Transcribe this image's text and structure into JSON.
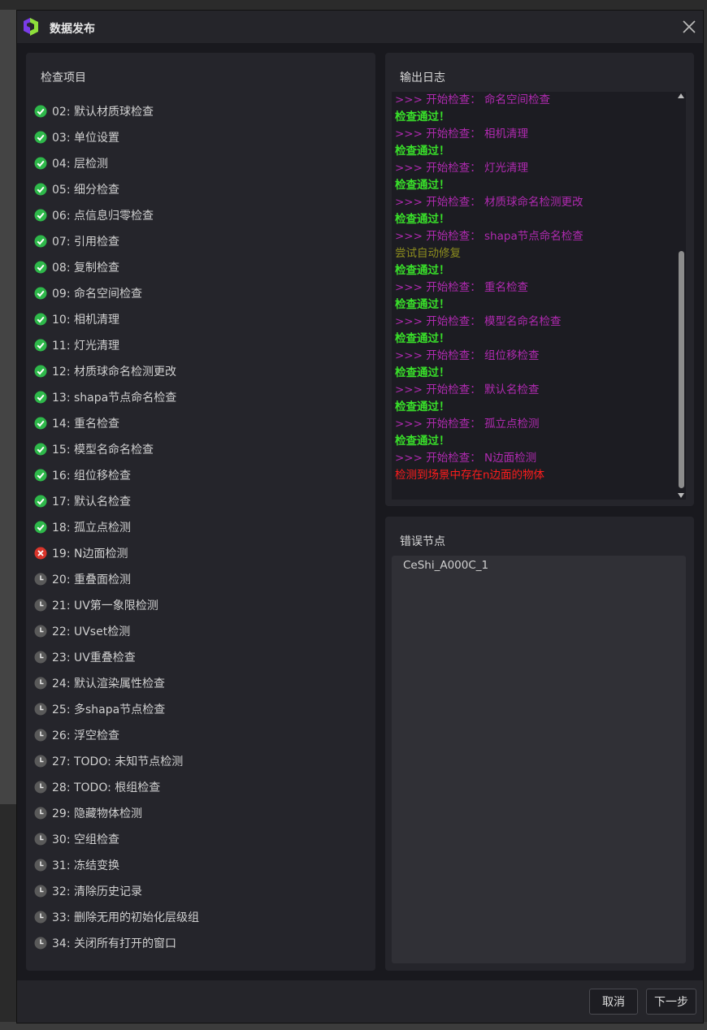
{
  "window": {
    "title": "数据发布"
  },
  "check_panel": {
    "title": "检查项目",
    "items": [
      {
        "label": "02: 默认材质球检查",
        "status": "passed"
      },
      {
        "label": "03: 单位设置",
        "status": "passed"
      },
      {
        "label": "04: 层检测",
        "status": "passed"
      },
      {
        "label": "05: 细分检查",
        "status": "passed"
      },
      {
        "label": "06: 点信息归零检查",
        "status": "passed"
      },
      {
        "label": "07: 引用检查",
        "status": "passed"
      },
      {
        "label": "08: 复制检查",
        "status": "passed"
      },
      {
        "label": "09: 命名空间检查",
        "status": "passed"
      },
      {
        "label": "10: 相机清理",
        "status": "passed"
      },
      {
        "label": "11: 灯光清理",
        "status": "passed"
      },
      {
        "label": "12: 材质球命名检测更改",
        "status": "passed"
      },
      {
        "label": "13: shapa节点命名检查",
        "status": "passed"
      },
      {
        "label": "14: 重名检查",
        "status": "passed"
      },
      {
        "label": "15: 模型名命名检查",
        "status": "passed"
      },
      {
        "label": "16: 组位移检查",
        "status": "passed"
      },
      {
        "label": "17: 默认名检查",
        "status": "passed"
      },
      {
        "label": "18: 孤立点检测",
        "status": "passed"
      },
      {
        "label": "19: N边面检测",
        "status": "failed"
      },
      {
        "label": "20: 重叠面检测",
        "status": "pending"
      },
      {
        "label": "21: UV第一象限检测",
        "status": "pending"
      },
      {
        "label": "22: UVset检测",
        "status": "pending"
      },
      {
        "label": "23: UV重叠检查",
        "status": "pending"
      },
      {
        "label": "24: 默认渲染属性检查",
        "status": "pending"
      },
      {
        "label": "25: 多shapa节点检查",
        "status": "pending"
      },
      {
        "label": "26: 浮空检查",
        "status": "pending"
      },
      {
        "label": "27: TODO: 未知节点检测",
        "status": "pending"
      },
      {
        "label": "28: TODO: 根组检查",
        "status": "pending"
      },
      {
        "label": "29: 隐藏物体检测",
        "status": "pending"
      },
      {
        "label": "30: 空组检查",
        "status": "pending"
      },
      {
        "label": "31: 冻结变换",
        "status": "pending"
      },
      {
        "label": "32: 清除历史记录",
        "status": "pending"
      },
      {
        "label": "33: 删除无用的初始化层级组",
        "status": "pending"
      },
      {
        "label": "34: 关闭所有打开的窗口",
        "status": "pending"
      }
    ]
  },
  "log_panel": {
    "title": "输出日志",
    "lines": [
      {
        "text": ">>> 开始检查： 命名空间检查",
        "kind": "start"
      },
      {
        "text": "检查通过！",
        "kind": "pass"
      },
      {
        "text": ">>> 开始检查： 相机清理",
        "kind": "start"
      },
      {
        "text": "检查通过！",
        "kind": "pass"
      },
      {
        "text": ">>> 开始检查： 灯光清理",
        "kind": "start"
      },
      {
        "text": "检查通过！",
        "kind": "pass"
      },
      {
        "text": ">>> 开始检查： 材质球命名检测更改",
        "kind": "start"
      },
      {
        "text": "检查通过！",
        "kind": "pass"
      },
      {
        "text": ">>> 开始检查： shapa节点命名检查",
        "kind": "start"
      },
      {
        "text": "尝试自动修复",
        "kind": "fix"
      },
      {
        "text": "检查通过！",
        "kind": "pass"
      },
      {
        "text": ">>> 开始检查： 重名检查",
        "kind": "start"
      },
      {
        "text": "检查通过！",
        "kind": "pass"
      },
      {
        "text": ">>> 开始检查： 模型名命名检查",
        "kind": "start"
      },
      {
        "text": "检查通过！",
        "kind": "pass"
      },
      {
        "text": ">>> 开始检查： 组位移检查",
        "kind": "start"
      },
      {
        "text": "检查通过！",
        "kind": "pass"
      },
      {
        "text": ">>> 开始检查： 默认名检查",
        "kind": "start"
      },
      {
        "text": "检查通过！",
        "kind": "pass"
      },
      {
        "text": ">>> 开始检查： 孤立点检测",
        "kind": "start"
      },
      {
        "text": "检查通过！",
        "kind": "pass"
      },
      {
        "text": ">>> 开始检查： N边面检测",
        "kind": "start"
      },
      {
        "text": "检测到场景中存在n边面的物体",
        "kind": "error"
      }
    ]
  },
  "error_panel": {
    "title": "错误节点",
    "items": [
      "CeShi_A000C_1"
    ]
  },
  "footer": {
    "cancel_label": "取消",
    "next_label": "下一步"
  },
  "colors": {
    "passed": "#2eb84a",
    "failed": "#d9352b",
    "pending": "#5a5a5a",
    "log_start": "#b02ab0",
    "log_pass": "#39e02a",
    "log_fix": "#8c8c1e",
    "log_error": "#ff1c1c"
  }
}
